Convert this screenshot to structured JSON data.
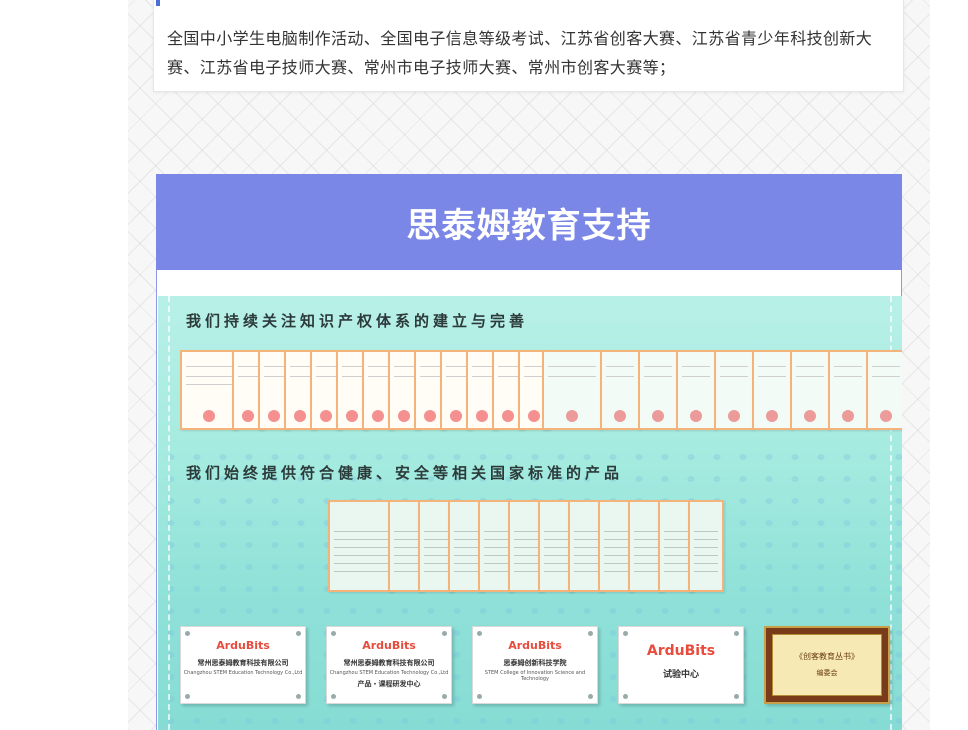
{
  "intro": {
    "text": "全国中小学生电脑制作活动、全国电子信息等级考试、江苏省创客大赛、江苏省青少年科技创新大赛、江苏省电子技师大赛、常州市电子技师大赛、常州市创客大赛等；"
  },
  "banner": {
    "title": "思泰姆教育支持"
  },
  "poster": {
    "ip_heading": "我们持续关注知识产权体系的建立与完善",
    "standard_heading": "我们始终提供符合健康、安全等相关国家标准的产品"
  },
  "plaques": [
    {
      "logo": "ArduBits",
      "line1": "常州思泰姆教育科技有限公司",
      "line2": "Changzhou STEM Education Technology Co.,Ltd",
      "line3": ""
    },
    {
      "logo": "ArduBits",
      "line1": "常州思泰姆教育科技有限公司",
      "line2": "Changzhou STEM Education Technology Co.,Ltd",
      "line3": "产品・课程研发中心"
    },
    {
      "logo": "ArduBits",
      "line1": "思泰姆创新科技学院",
      "line2": "STEM College of Innovation Science and Technology",
      "line3": ""
    },
    {
      "logo": "ArduBits",
      "line1": "试验中心",
      "line2": "",
      "line3": ""
    }
  ],
  "gold_plaque": {
    "title": "《创客教育丛书》",
    "subtitle": "编委会"
  },
  "colors": {
    "banner": "#7b87e6",
    "accent": "#4a6fd6",
    "poster": "#a6ebe0"
  }
}
